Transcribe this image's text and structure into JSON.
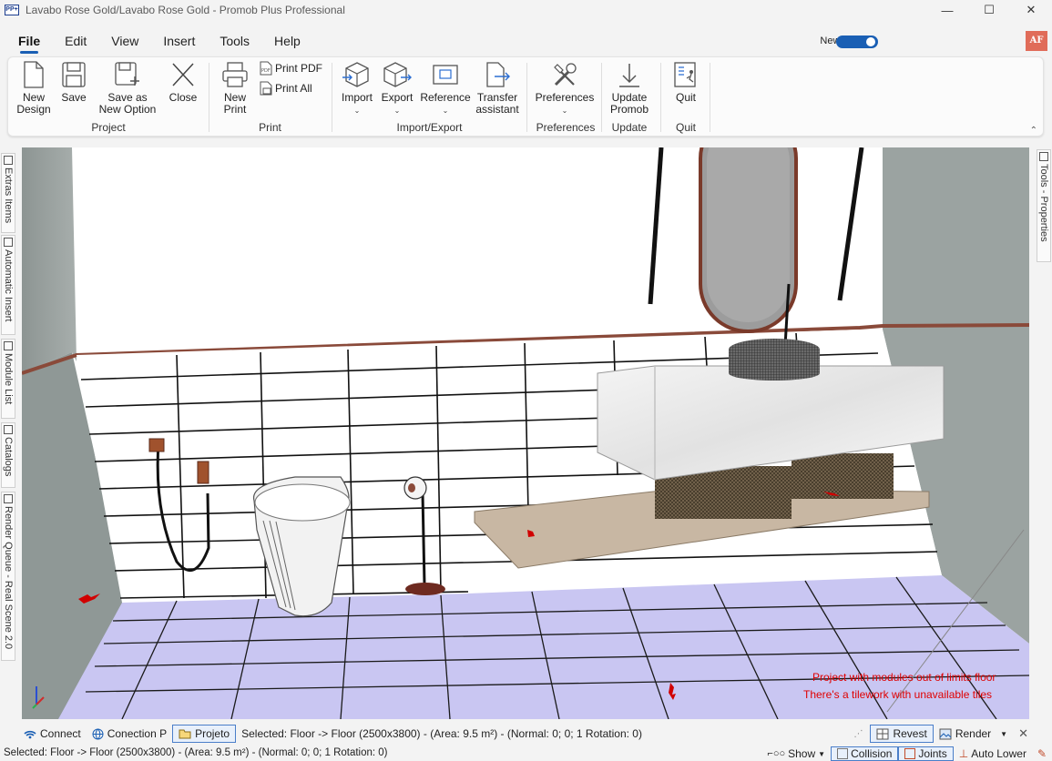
{
  "window": {
    "title": "Lavabo Rose Gold/Lavabo Rose Gold - Promob Plus Professional",
    "app_icon_text": "PP+",
    "controls": {
      "minimize": "—",
      "maximize": "☐",
      "close": "✕"
    }
  },
  "menu": {
    "items": [
      "File",
      "Edit",
      "View",
      "Insert",
      "Tools",
      "Help"
    ],
    "active": "File",
    "new_promob_label": "New Promob",
    "new_promob_enabled": true,
    "avatar_initials": "AF",
    "avatar_color": "#e06c59"
  },
  "ribbon": {
    "project": {
      "label": "Project",
      "new_design": "New Design",
      "save": "Save",
      "save_as_new_option": "Save as New Option",
      "close": "Close"
    },
    "print": {
      "label": "Print",
      "new_print": "New Print",
      "print_pdf": "Print PDF",
      "print_all": "Print All"
    },
    "import_export": {
      "label": "Import/Export",
      "import": "Import",
      "export": "Export",
      "reference": "Reference",
      "transfer_assistant": "Transfer assistant"
    },
    "preferences": {
      "label": "Preferences",
      "preferences": "Preferences"
    },
    "update": {
      "label": "Update",
      "update_promob": "Update Promob"
    },
    "quit": {
      "label": "Quit",
      "quit": "Quit"
    }
  },
  "side_tabs_left": [
    "Extras Items",
    "Automatic Insert",
    "Module List",
    "Catalogs",
    "Render Queue - Real Scene 2.0"
  ],
  "side_tabs_right": [
    "Tools - Properties"
  ],
  "viewport": {
    "warnings": [
      "Project with modules out of limits floor",
      "There's a tilework with unavailable tiles"
    ]
  },
  "toolbar": {
    "connect": "Connect",
    "conection_p": "Conection P",
    "projeto": "Projeto",
    "selected_text": "Selected: Floor -> Floor (2500x3800) - (Area: 9.5 m²) - (Normal: 0; 0; 1 Rotation: 0)",
    "revest": "Revest",
    "render": "Render"
  },
  "statusbar": {
    "selected_text": "Selected: Floor -> Floor (2500x3800) - (Area: 9.5 m²) - (Normal: 0; 0; 1 Rotation: 0)",
    "show": "Show",
    "collision": "Collision",
    "joints": "Joints",
    "auto_lower": "Auto Lower"
  },
  "colors": {
    "accent": "#1a5fb4",
    "warning": "#e00000",
    "floor_tile": "#c9c6f2",
    "wall": "#ffffff",
    "side_wall": "#9aa2a0",
    "rose_gold_trim": "#8a4a3a"
  }
}
